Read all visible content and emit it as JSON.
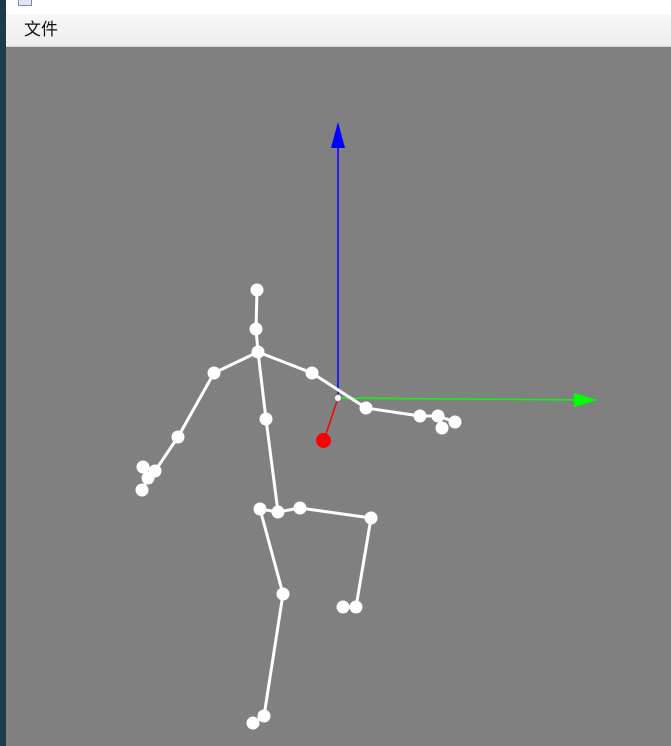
{
  "menubar": {
    "file_menu_label": "文件"
  },
  "viewport": {
    "background_color": "#808080",
    "skeleton_color": "#ffffff",
    "axes": {
      "x_axis_color": "#00ff00",
      "y_axis_color": "#0000ff",
      "z_axis_color": "#ff0000"
    }
  },
  "icons": {
    "window_icon": "app-window-icon"
  }
}
